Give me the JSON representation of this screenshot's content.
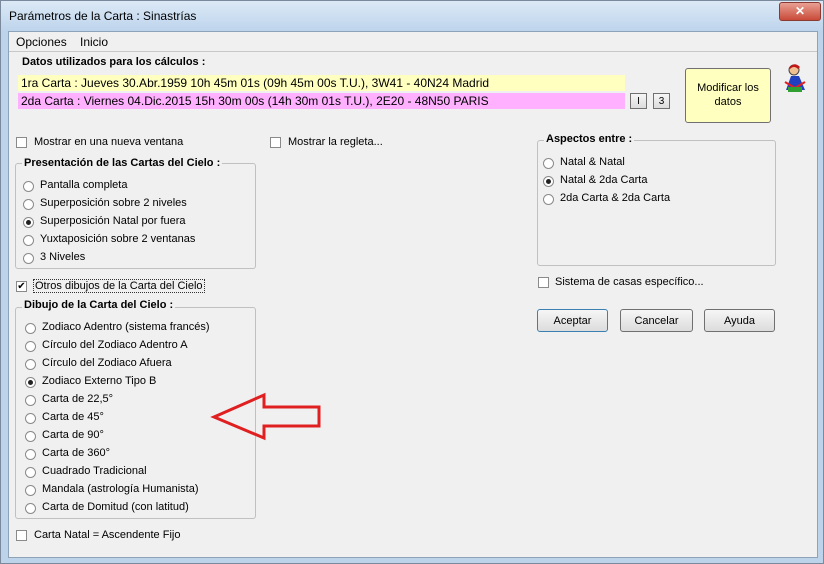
{
  "window": {
    "title": "Parámetros de la Carta : Sinastrías"
  },
  "menu": [
    "Opciones",
    "Inicio"
  ],
  "datos": {
    "label": "Datos utilizados para los cálculos :",
    "carta1": "1ra Carta : Jueves 30.Abr.1959 10h 45m 01s (09h 45m 00s T.U.), 3W41 - 40N24  Madrid",
    "carta2": "2da Carta : Viernes 04.Dic.2015 15h 30m 00s (14h 30m 01s T.U.), 2E20 - 48N50  PARIS",
    "btn_i": "I",
    "btn_3": "3",
    "modificar_line1": "Modificar los",
    "modificar_line2": "datos",
    "color_carta1": "#ffffc0",
    "color_carta2": "#ffb0ff"
  },
  "options": {
    "nueva_ventana": "Mostrar en una nueva ventana",
    "regleta": "Mostrar la regleta...",
    "otros_dibujos": "Otros dibujos de la Carta del Cielo",
    "sistema_casas": "Sistema de casas específico...",
    "ascendente_fijo": "Carta Natal = Ascendente Fijo"
  },
  "presentacion": {
    "label": "Presentación de las Cartas del Cielo :",
    "items": [
      "Pantalla completa",
      "Superposición sobre 2 niveles",
      "Superposición Natal por fuera",
      "Yuxtaposición sobre 2 ventanas",
      "3 Niveles"
    ],
    "selected": 2
  },
  "dibujo": {
    "label": "Dibujo de la Carta del Cielo :",
    "items": [
      "Zodiaco Adentro (sistema francés)",
      "Círculo del Zodiaco Adentro A",
      "Círculo del Zodiaco Afuera",
      "Zodiaco Externo Tipo B",
      "Carta de 22,5°",
      "Carta de 45°",
      "Carta de 90°",
      "Carta de 360°",
      "Cuadrado Tradicional",
      "Mandala (astrología Humanista)",
      "Carta de Domitud (con latitud)"
    ],
    "selected": 3
  },
  "aspectos": {
    "label": "Aspectos entre :",
    "items": [
      "Natal  & Natal",
      "Natal  & 2da Carta",
      "2da Carta & 2da Carta"
    ],
    "selected": 1
  },
  "buttons": {
    "aceptar": "Aceptar",
    "cancelar": "Cancelar",
    "ayuda": "Ayuda"
  },
  "colors": {
    "arrow": "#e02020"
  }
}
